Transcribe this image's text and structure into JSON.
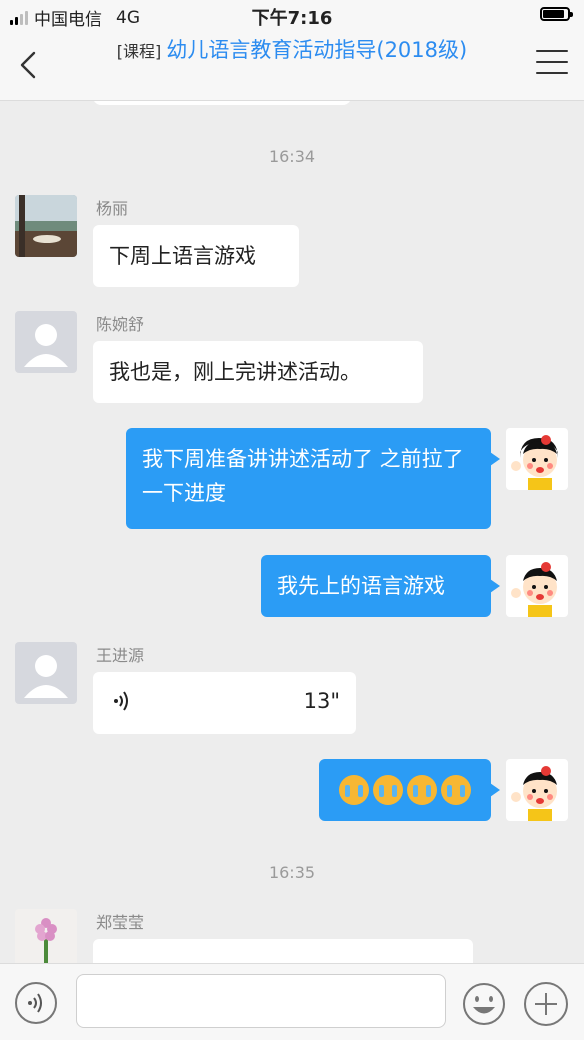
{
  "status_bar": {
    "carrier": "中国电信",
    "network": "4G",
    "time": "下午7:16"
  },
  "nav": {
    "tag": "[课程]",
    "title": "幼儿语言教育活动指导(2018级)",
    "title_color": "#2c8cf0"
  },
  "colors": {
    "outgoing_bubble": "#2b9cf5",
    "incoming_bubble": "#ffffff",
    "background": "#ededed"
  },
  "chat": {
    "timestamps": [
      "16:34",
      "16:35"
    ],
    "messages": [
      {
        "sender": "杨丽",
        "direction": "in",
        "type": "text",
        "text": "下周上语言游戏"
      },
      {
        "sender": "陈婉舒",
        "direction": "in",
        "type": "text",
        "text": "我也是，刚上完讲述活动。"
      },
      {
        "sender": "",
        "direction": "out",
        "type": "text",
        "text": "我下周准备讲讲述活动了 之前拉了一下进度"
      },
      {
        "sender": "",
        "direction": "out",
        "type": "text",
        "text": "我先上的语言游戏"
      },
      {
        "sender": "王进源",
        "direction": "in",
        "type": "voice",
        "duration": "13\""
      },
      {
        "sender": "",
        "direction": "out",
        "type": "emoji",
        "emoji": "loudly-crying-face",
        "count": 4
      },
      {
        "sender": "郑莹莹",
        "direction": "in",
        "type": "text",
        "text": ""
      }
    ]
  },
  "input_bar": {
    "placeholder": "",
    "icons": [
      "voice-icon",
      "smiley-icon",
      "plus-icon"
    ]
  }
}
